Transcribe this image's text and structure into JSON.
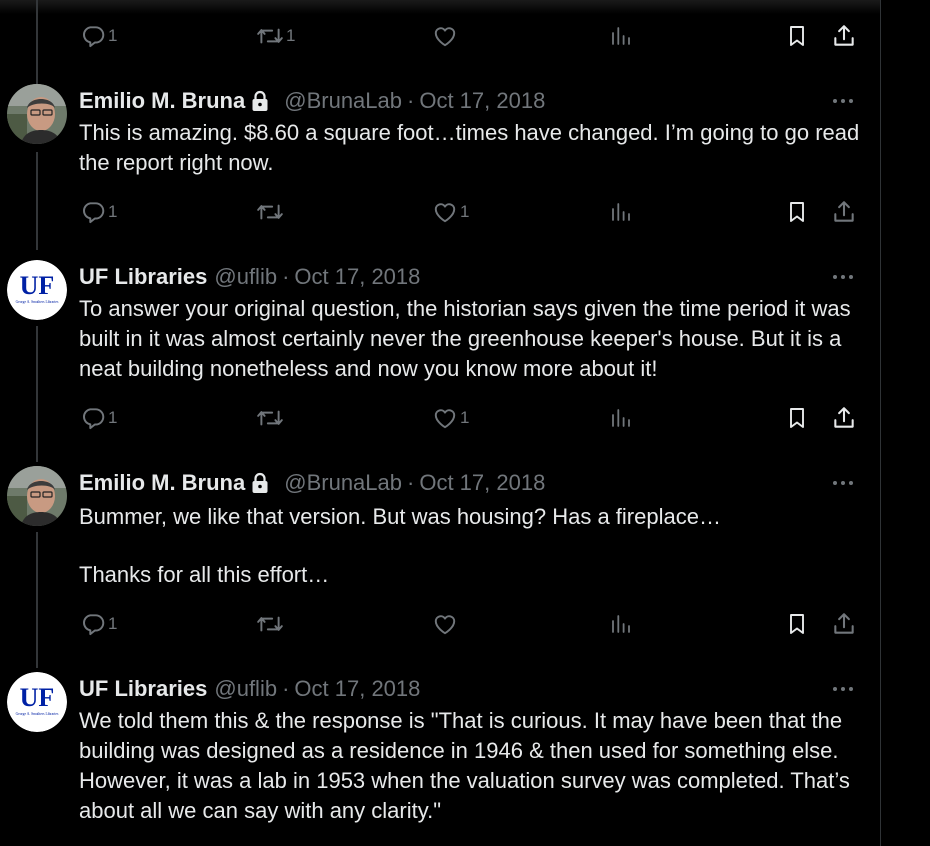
{
  "top_actions": {
    "reply_count": "1",
    "retweet_count": "1",
    "like_count": ""
  },
  "tweets": [
    {
      "name": "Emilio M. Bruna",
      "handle": "@BrunaLab",
      "date": "Oct 17, 2018",
      "paragraphs": [
        "This is amazing. $8.60 a square foot…times have changed.  I’m going to go read the report right now."
      ],
      "reply_count": "1",
      "retweet_count": "",
      "like_count": "1"
    },
    {
      "name": "UF Libraries",
      "handle": "@uflib",
      "date": "Oct 17, 2018",
      "paragraphs": [
        "To answer your original question, the historian says given the time period it was built in it was almost certainly never the greenhouse keeper's house. But it is a neat building nonetheless and now you know more about it!"
      ],
      "reply_count": "1",
      "retweet_count": "",
      "like_count": "1"
    },
    {
      "name": "Emilio M. Bruna",
      "handle": "@BrunaLab",
      "date": "Oct 17, 2018",
      "paragraphs": [
        "Bummer, we like that version. But was housing? Has a fireplace…",
        "Thanks for all this effort…"
      ],
      "reply_count": "1",
      "retweet_count": "",
      "like_count": ""
    },
    {
      "name": "UF Libraries",
      "handle": "@uflib",
      "date": "Oct 17, 2018",
      "paragraphs": [
        "We told them this & the response is \"That is curious. It may have been that the building was designed as a residence in 1946 & then used for something else. However, it was a lab in 1953 when the valuation survey was completed. That’s about all we can say with any clarity.\""
      ]
    }
  ],
  "uf_logo": {
    "letters": "UF",
    "subtext": "George A. Smathers Libraries"
  },
  "colors": {
    "background": "#000000",
    "text": "#e7e9ea",
    "muted": "#71767b",
    "uf_blue": "#0021a5",
    "border": "#2f3336"
  }
}
